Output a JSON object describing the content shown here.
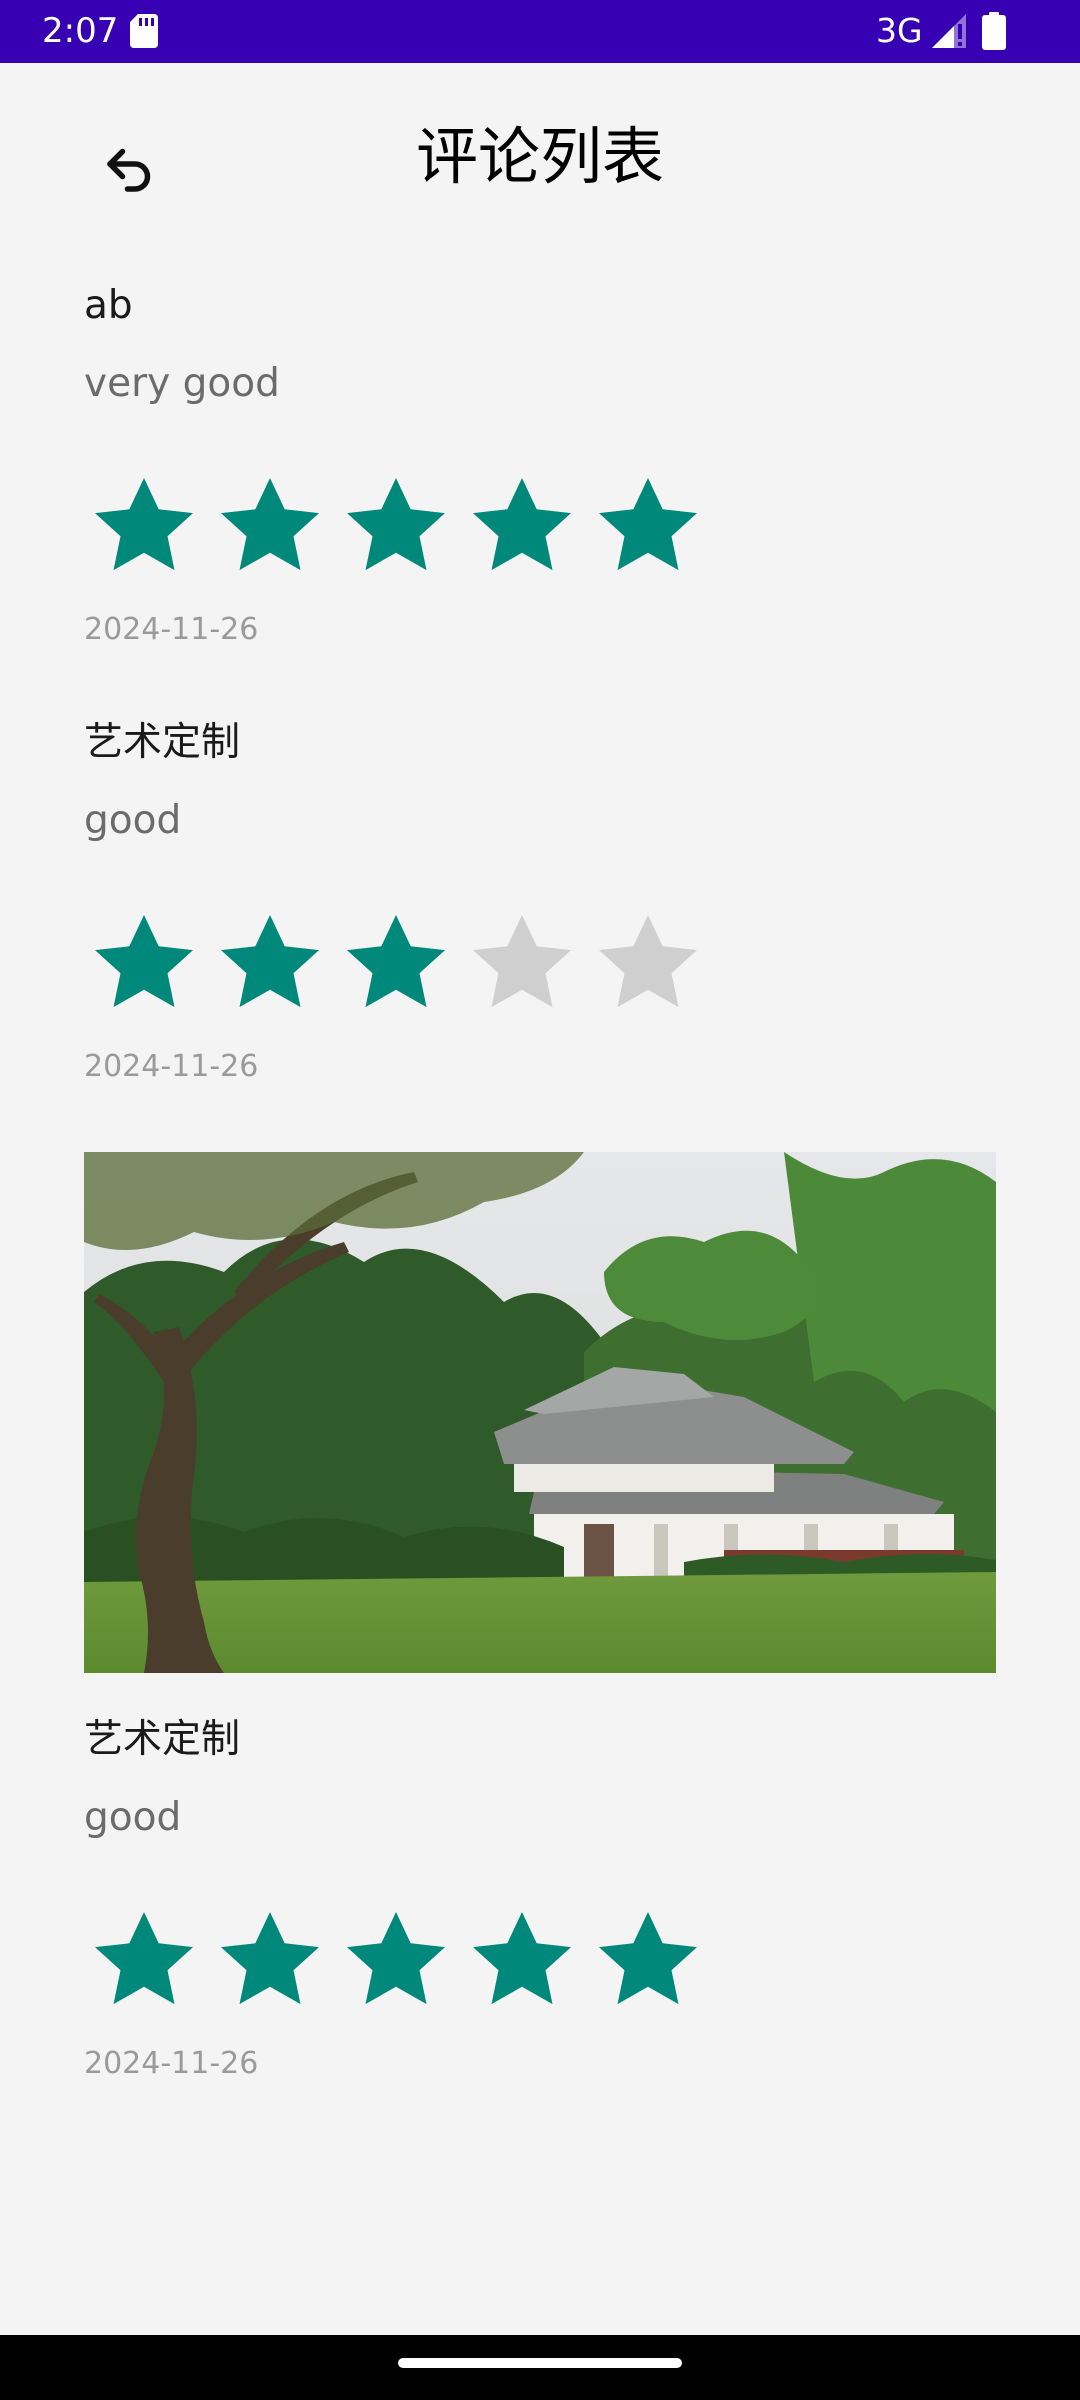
{
  "status_bar": {
    "time": "2:07",
    "network": "3G",
    "background_color": "#3700b3",
    "icons": [
      "sd-card-icon",
      "signal-icon",
      "battery-icon"
    ]
  },
  "header": {
    "title": "评论列表",
    "back_icon": "undo-arrow-icon"
  },
  "theme": {
    "star_filled_color": "#00897b",
    "star_empty_color": "#cfcfcf"
  },
  "reviews": [
    {
      "title": "ab",
      "content": "very good",
      "rating": 5,
      "max_rating": 5,
      "date": "2024-11-26",
      "has_image": false
    },
    {
      "title": "艺术定制",
      "content": "good",
      "rating": 3,
      "max_rating": 5,
      "date": "2024-11-26",
      "has_image": false
    },
    {
      "title": "艺术定制",
      "content": "good",
      "rating": 5,
      "max_rating": 5,
      "date": "2024-11-26",
      "has_image": true
    }
  ]
}
